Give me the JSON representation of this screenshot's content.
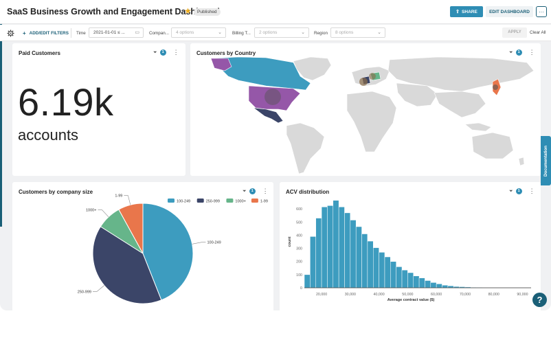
{
  "header": {
    "title": "SaaS Business Growth and Engagement Dashboard",
    "status": "Published",
    "share_label": "SHARE",
    "edit_label": "EDIT DASHBOARD",
    "more_label": "···"
  },
  "filters": {
    "add_label": "ADD/EDIT FILTERS",
    "items": [
      {
        "label": "Time",
        "value": "2021-01-01 ≤ ..."
      },
      {
        "label": "Compan...",
        "value": "4 options"
      },
      {
        "label": "Billing T...",
        "value": "2 options"
      },
      {
        "label": "Region",
        "value": "8 options"
      }
    ],
    "apply_label": "APPLY",
    "clear_label": "Clear All"
  },
  "cards": {
    "paid": {
      "title": "Paid Customers",
      "value": "6.19k",
      "subtitle": "accounts",
      "filter_count": "1"
    },
    "country": {
      "title": "Customers by Country",
      "filter_count": "1"
    },
    "size": {
      "title": "Customers by company size",
      "filter_count": "1"
    },
    "acv": {
      "title": "ACV distribution",
      "filter_count": "1"
    }
  },
  "documentation_label": "Documentation",
  "help_label": "?",
  "colors": {
    "accent": "#2e8db4",
    "series_100_249": "#3d9cbf",
    "series_250_999": "#3b4568",
    "series_1000_plus": "#66b58a",
    "series_1_99": "#e9764b",
    "map_land": "#d9d9d9",
    "map_highlight_purple": "#9557a8"
  },
  "chart_data": [
    {
      "type": "pie",
      "title": "Customers by company size",
      "categories": [
        "100-249",
        "250-999",
        "1000+",
        "1-99"
      ],
      "values": [
        44,
        40,
        8,
        8
      ],
      "legend": [
        "100-249",
        "250-999",
        "1000+",
        "1-99"
      ],
      "legend_position": "top-right"
    },
    {
      "type": "bar",
      "title": "ACV distribution",
      "xlabel": "Average contract value ($)",
      "ylabel": "count",
      "xlim": [
        14000,
        93000
      ],
      "ylim": [
        0,
        700
      ],
      "x_ticks": [
        "20,000",
        "30,000",
        "40,000",
        "50,000",
        "60,000",
        "70,000",
        "80,000",
        "90,000"
      ],
      "y_ticks": [
        "0",
        "100",
        "200",
        "300",
        "400",
        "500",
        "600"
      ],
      "bin_width": 2000,
      "bin_start": 14000,
      "values": [
        100,
        390,
        530,
        615,
        625,
        665,
        615,
        570,
        515,
        465,
        410,
        355,
        305,
        270,
        235,
        200,
        160,
        135,
        115,
        90,
        75,
        55,
        40,
        30,
        20,
        15,
        10,
        8,
        6,
        4,
        3,
        2,
        1,
        1,
        1,
        0,
        0,
        1,
        0
      ]
    }
  ]
}
